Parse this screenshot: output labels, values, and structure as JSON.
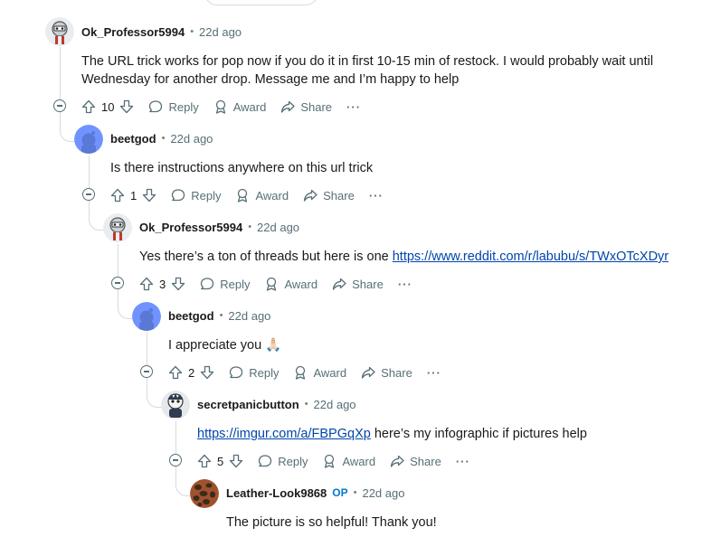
{
  "comments": [
    {
      "author": "Ok_Professor5994",
      "time": "22d ago",
      "body": "The URL trick works for pop now if you do it in first 10-15 min of restock. I would probably wait until Wednesday for another drop. Message me and I’m happy to help",
      "score": "10",
      "actions": {
        "reply": "Reply",
        "award": "Award",
        "share": "Share",
        "more": "···"
      }
    },
    {
      "author": "beetgod",
      "time": "22d ago",
      "body": "Is there instructions anywhere on this url trick",
      "score": "1",
      "actions": {
        "reply": "Reply",
        "award": "Award",
        "share": "Share",
        "more": "···"
      }
    },
    {
      "author": "Ok_Professor5994",
      "time": "22d ago",
      "body_prefix": "Yes there’s a ton of threads but here is one ",
      "body_link": "https://www.reddit.com/r/labubu/s/TWxOTcXDyr",
      "score": "3",
      "actions": {
        "reply": "Reply",
        "award": "Award",
        "share": "Share",
        "more": "···"
      }
    },
    {
      "author": "beetgod",
      "time": "22d ago",
      "body": "I appreciate you 🙏🏻",
      "score": "2",
      "actions": {
        "reply": "Reply",
        "award": "Award",
        "share": "Share",
        "more": "···"
      }
    },
    {
      "author": "secretpanicbutton",
      "time": "22d ago",
      "body_link": "https://imgur.com/a/FBPGqXp",
      "body_suffix": " here’s my infographic if pictures help",
      "score": "5",
      "actions": {
        "reply": "Reply",
        "award": "Award",
        "share": "Share",
        "more": "···"
      }
    },
    {
      "author": "Leather-Look9868",
      "op_badge": "OP",
      "time": "22d ago",
      "body": "The picture is so helpful! Thank you!"
    }
  ],
  "colors": {
    "link": "#0045ac",
    "op": "#0079d3",
    "muted": "#576f76",
    "thread": "#d7dadc"
  },
  "icons": [
    "upvote-icon",
    "downvote-icon",
    "reply-icon",
    "award-icon",
    "share-icon",
    "collapse-icon"
  ]
}
